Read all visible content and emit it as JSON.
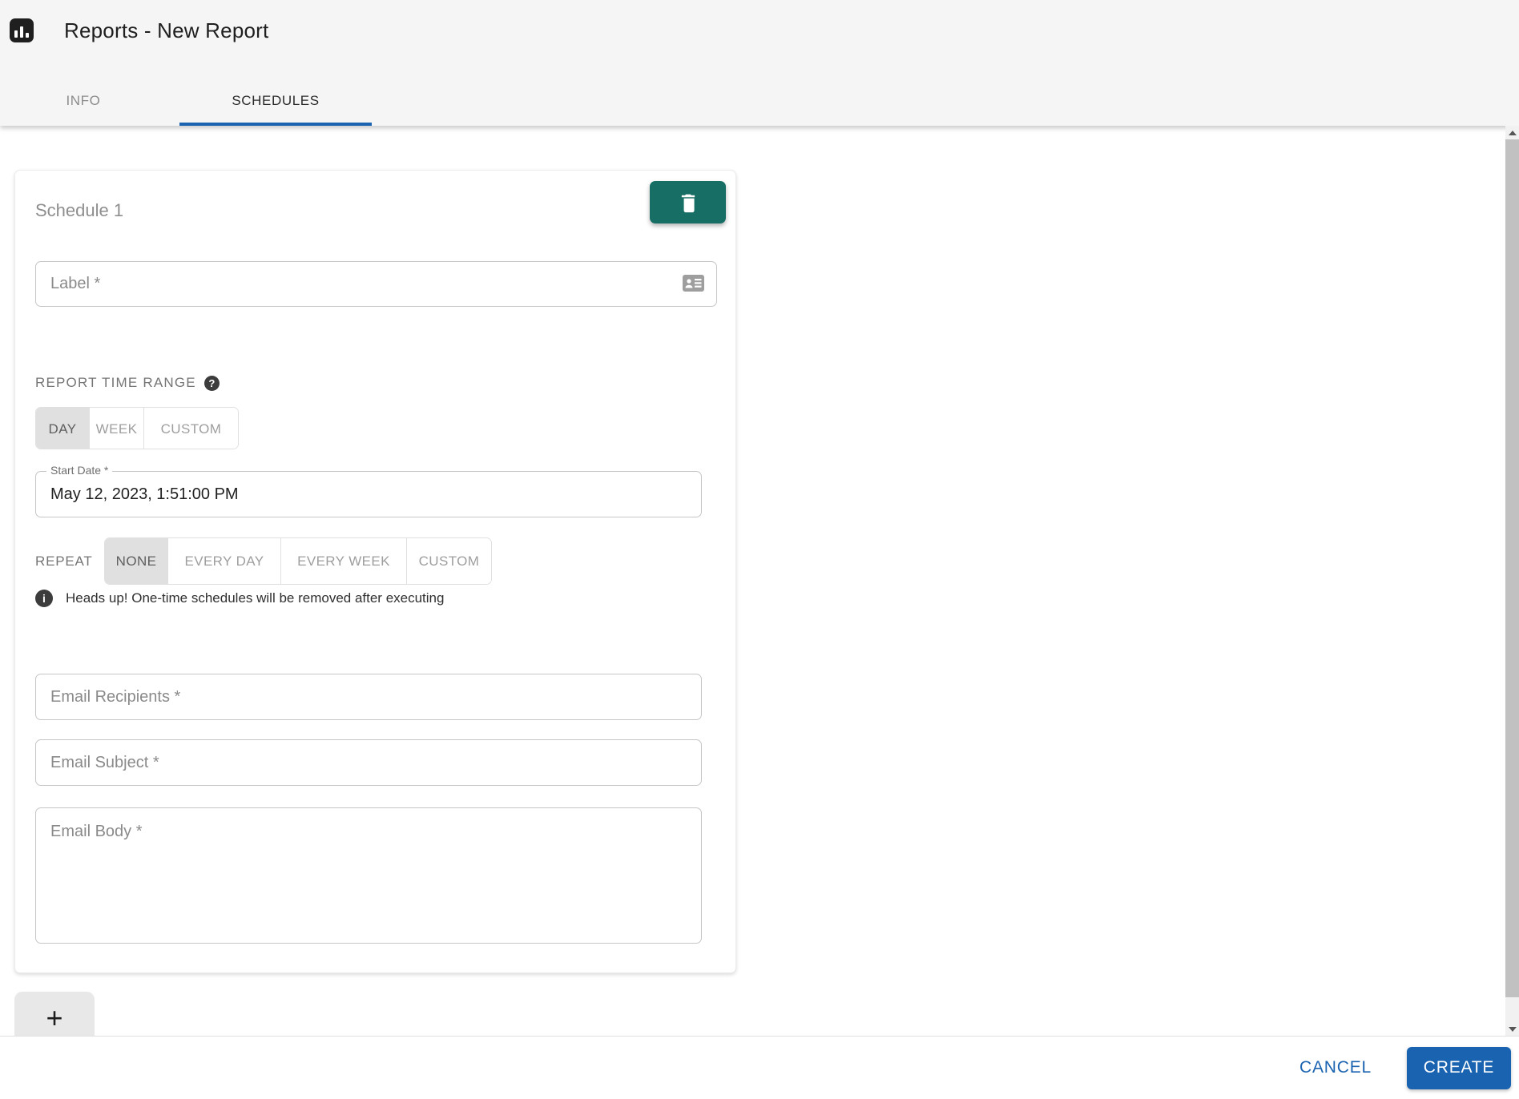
{
  "header": {
    "title": "Reports - New Report",
    "tabs": [
      {
        "label": "INFO",
        "active": false
      },
      {
        "label": "SCHEDULES",
        "active": true
      }
    ]
  },
  "schedule_card": {
    "title": "Schedule 1",
    "label_field": {
      "placeholder": "Label *",
      "value": ""
    },
    "time_range": {
      "label": "REPORT TIME RANGE",
      "help_glyph": "?",
      "options": [
        "DAY",
        "WEEK",
        "CUSTOM"
      ],
      "selected": "DAY"
    },
    "start_date": {
      "label": "Start Date *",
      "value": "May 12, 2023, 1:51:00 PM"
    },
    "repeat": {
      "label": "REPEAT",
      "options": [
        "NONE",
        "EVERY DAY",
        "EVERY WEEK",
        "CUSTOM"
      ],
      "selected": "NONE",
      "notice_glyph": "i",
      "notice": "Heads up! One-time schedules will be removed after executing"
    },
    "email": {
      "recipients_placeholder": "Email Recipients *",
      "recipients_value": "",
      "subject_placeholder": "Email Subject *",
      "subject_value": "",
      "body_placeholder": "Email Body *",
      "body_value": ""
    }
  },
  "add_button_label": "+",
  "footer": {
    "cancel_label": "CANCEL",
    "create_label": "CREATE"
  },
  "colors": {
    "accent_blue": "#1a63b0",
    "teal": "#176e64",
    "header_bg": "#f5f5f5"
  }
}
